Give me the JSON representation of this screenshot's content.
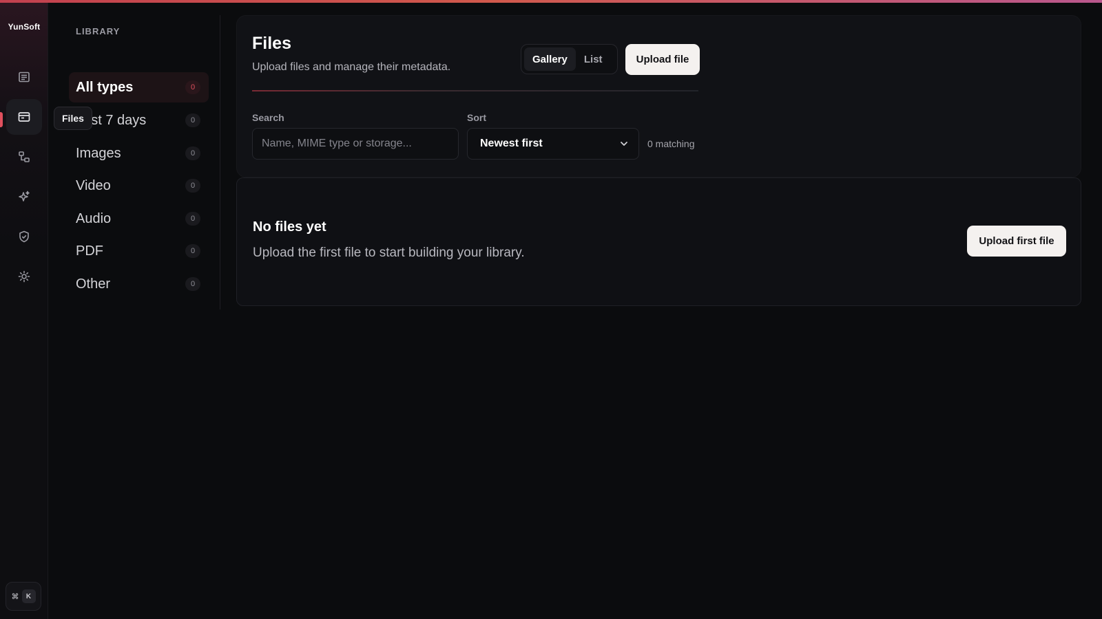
{
  "app": {
    "brand": "YunSoft"
  },
  "rail": {
    "items": [
      {
        "icon": "list-icon",
        "label": "Overview"
      },
      {
        "icon": "folder-icon",
        "label": "Files",
        "active": true
      },
      {
        "icon": "flow-icon",
        "label": "Workflows"
      },
      {
        "icon": "sparkle-icon",
        "label": "AI"
      },
      {
        "icon": "shield-icon",
        "label": "Security"
      },
      {
        "icon": "gear-icon",
        "label": "Settings"
      }
    ],
    "tooltip": "Files",
    "shortcut": {
      "symbol": "⌘",
      "key": "K"
    }
  },
  "library": {
    "title": "LIBRARY",
    "items": [
      {
        "label": "All types",
        "count": "0",
        "active": true
      },
      {
        "label": "Last 7 days",
        "count": "0"
      },
      {
        "label": "Images",
        "count": "0"
      },
      {
        "label": "Video",
        "count": "0"
      },
      {
        "label": "Audio",
        "count": "0"
      },
      {
        "label": "PDF",
        "count": "0"
      },
      {
        "label": "Other",
        "count": "0"
      }
    ]
  },
  "header": {
    "title": "Files",
    "subtitle": "Upload files and manage their metadata.",
    "view_toggle": {
      "gallery": "Gallery",
      "list": "List",
      "selected": "Gallery"
    },
    "upload_button": "Upload file"
  },
  "filters": {
    "search_label": "Search",
    "search_placeholder": "Name, MIME type or storage...",
    "search_value": "",
    "sort_label": "Sort",
    "sort_value": "Newest first",
    "matching": "0 matching"
  },
  "empty_state": {
    "title": "No files yet",
    "description": "Upload the first file to start building your library.",
    "button": "Upload first file"
  },
  "colors": {
    "accent": "#e0505e",
    "background": "#0b0c0e",
    "card": "#111216",
    "button_light": "#f4f1ef"
  }
}
